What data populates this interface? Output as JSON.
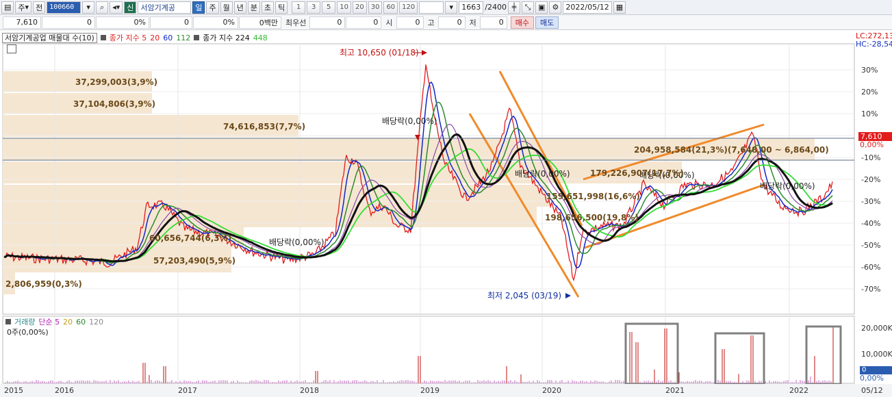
{
  "toolbar": {
    "period_type": "주",
    "prev_label": "전",
    "stock_code": "100660",
    "stock_name": "서암기계공",
    "badge": "신",
    "tab_day": "일",
    "tab_week": "주",
    "tab_month": "월",
    "tab_year": "년",
    "tab_min": "분",
    "tab_sec": "초",
    "tab_tick": "틱",
    "intervals": [
      "1",
      "3",
      "5",
      "10",
      "20",
      "30",
      "60",
      "120"
    ],
    "count": "1663",
    "count_total": "/2400",
    "date": "2022/05/12"
  },
  "quote": {
    "price": "7,610",
    "change": "0",
    "change_pct": "0%",
    "vol_a": "0",
    "vol_pct": "0%",
    "vol_b": "0백만",
    "pref_label": "최우선",
    "pref_a": "0",
    "pref_b": "0",
    "open_label": "시",
    "open": "0",
    "high_label": "고",
    "high": "0",
    "low_label": "저",
    "low": "0",
    "buy_label": "매수",
    "sell_label": "매도"
  },
  "legend": {
    "box_label": "서암기계공업 매물대 수(10)",
    "ma_label": "종가 지수 5",
    "ma20": "20",
    "ma60": "60",
    "ma112": "112",
    "ma224_label": "종가 지수 224",
    "ma448": "448"
  },
  "volume_legend": {
    "label": "거래량",
    "simple_label": "단순 5",
    "m20": "20",
    "m60": "60",
    "m120": "120",
    "sub": "0주(0,00%)"
  },
  "tags": {
    "lc": "LC:272,13",
    "hc": "HC:-28,54",
    "price": "7,610",
    "price_pct": "0,00%",
    "vol": "0",
    "vol_pct": "0,00%"
  },
  "colors": {
    "ma5": "#e11b1b",
    "ma20": "#1026c8",
    "ma60": "#2c8a2c",
    "ma112": "#8a4aa8",
    "ma224": "#111111",
    "ma448": "#33dd33",
    "volume_profile": "#f5e6d1",
    "trend": "#f08a2a",
    "highlight_box": "#808080"
  },
  "chart_data": {
    "type": "line",
    "y_axis_ticks": [
      "30%",
      "20%",
      "10%",
      "0%",
      "-10%",
      "-20%",
      "-30%",
      "-40%",
      "-50%",
      "-60%",
      "-70%"
    ],
    "x_axis_ticks": [
      "2015",
      "2016",
      "2017",
      "2018",
      "2019",
      "2020",
      "2021",
      "2022",
      "05/12"
    ],
    "volume_axis_ticks": [
      "20,000K",
      "10,000K",
      "0"
    ],
    "volume_profile": [
      {
        "label": "37,299,003(3,9%)"
      },
      {
        "label": "37,104,806(3,9%)"
      },
      {
        "label": "74,616,853(7,7%)"
      },
      {
        "label": "204,958,584(21,3%)(7,648,00 ~ 6,864,00)"
      },
      {
        "label": "179,226,907(17,7%)"
      },
      {
        "label": "159,651,998(16,6%)"
      },
      {
        "label": "198,656,500(19,8%)"
      },
      {
        "label": "60,656,744(6,3%)"
      },
      {
        "label": "57,203,490(5,9%)"
      },
      {
        "label": "2,806,959(0,3%)"
      }
    ],
    "annotations": {
      "high": "최고 10,650 (01/18)",
      "low": "최저 2,045 (03/19)",
      "dividend_1": "배당락(0,00%)",
      "dividend_2": "배당락(0,00%)",
      "dividend_3": "배당락(0,00%)",
      "dividend_4": "배당락(0,00%)",
      "dividend_5": "배당락(0,00%)"
    }
  }
}
